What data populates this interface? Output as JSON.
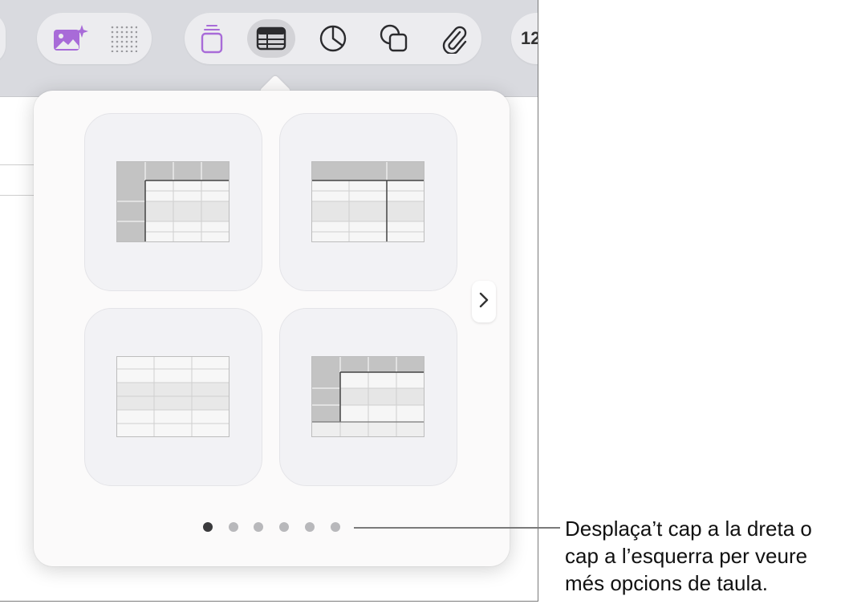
{
  "toolbar": {
    "media_buttons": [
      {
        "name": "image-playground-icon"
      },
      {
        "name": "dotted-grid-icon"
      }
    ],
    "insert_buttons": [
      {
        "name": "text-box-icon",
        "selected": false
      },
      {
        "name": "table-icon",
        "selected": true
      },
      {
        "name": "chart-icon",
        "selected": false
      },
      {
        "name": "shape-icon",
        "selected": false
      },
      {
        "name": "paperclip-icon",
        "selected": false
      }
    ],
    "right_label": "12"
  },
  "popover": {
    "table_styles": [
      {
        "name": "table-style-header-row-and-column"
      },
      {
        "name": "table-style-header-row"
      },
      {
        "name": "table-style-plain"
      },
      {
        "name": "table-style-header-footer"
      }
    ],
    "page_count": 6,
    "current_page": 1
  },
  "callout": {
    "lines": [
      "Desplaça’t cap a la dreta o",
      "cap a l’esquerra per veure",
      "més opcions de taula."
    ]
  },
  "colors": {
    "accent": "#9b59d9",
    "toolbar_bg": "#d9dadf",
    "active_dot": "#3a3a3c",
    "inactive_dot": "#b8b8bb"
  }
}
